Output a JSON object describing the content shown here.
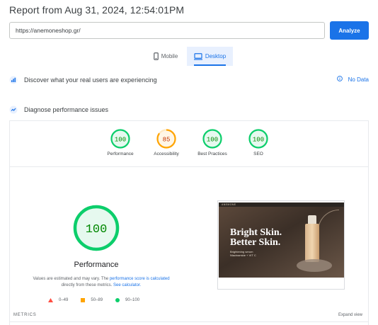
{
  "header": {
    "title": "Report from Aug 31, 2024, 12:54:01PM"
  },
  "search": {
    "url_value": "https://anemoneshop.gr/",
    "analyze_label": "Analyze"
  },
  "tabs": [
    {
      "label": "Mobile",
      "icon": "mobile-icon",
      "selected": false
    },
    {
      "label": "Desktop",
      "icon": "desktop-icon",
      "selected": true
    }
  ],
  "field_data": {
    "label": "Discover what your real users are experiencing",
    "status": "No Data"
  },
  "diagnose": {
    "label": "Diagnose performance issues"
  },
  "scores": [
    {
      "label": "Performance",
      "value": "100",
      "score": 100,
      "color": "#0cce6b"
    },
    {
      "label": "Accessibility",
      "value": "85",
      "score": 85,
      "color": "#ffa400"
    },
    {
      "label": "Best Practices",
      "value": "100",
      "score": 100,
      "color": "#0cce6b"
    },
    {
      "label": "SEO",
      "value": "100",
      "score": 100,
      "color": "#0cce6b"
    }
  ],
  "performance": {
    "score": "100",
    "score_value": 100,
    "title": "Performance",
    "note_prefix": "Values are estimated and may vary. The ",
    "note_link": "performance score is calculated",
    "note_middle": " directly from these metrics. ",
    "note_link2": "See calculator."
  },
  "legend": [
    {
      "label": "0–49",
      "shape": "triangle",
      "color": "#ff4e42"
    },
    {
      "label": "50–89",
      "shape": "square",
      "color": "#ffa400"
    },
    {
      "label": "90–100",
      "shape": "circle",
      "color": "#0cce6b"
    }
  ],
  "metrics": {
    "label": "METRICS",
    "expand_label": "Expand view"
  },
  "preview": {
    "brand": "ANEMONE",
    "headline_line1": "Bright Skin.",
    "headline_line2": "Better Skin.",
    "sub_line1": "Brightening serum",
    "sub_line2": "Niacinamide + VIT C"
  },
  "colors": {
    "accent": "#1a73e8",
    "pass": "#0cce6b",
    "average": "#ffa400",
    "fail": "#ff4e42"
  }
}
